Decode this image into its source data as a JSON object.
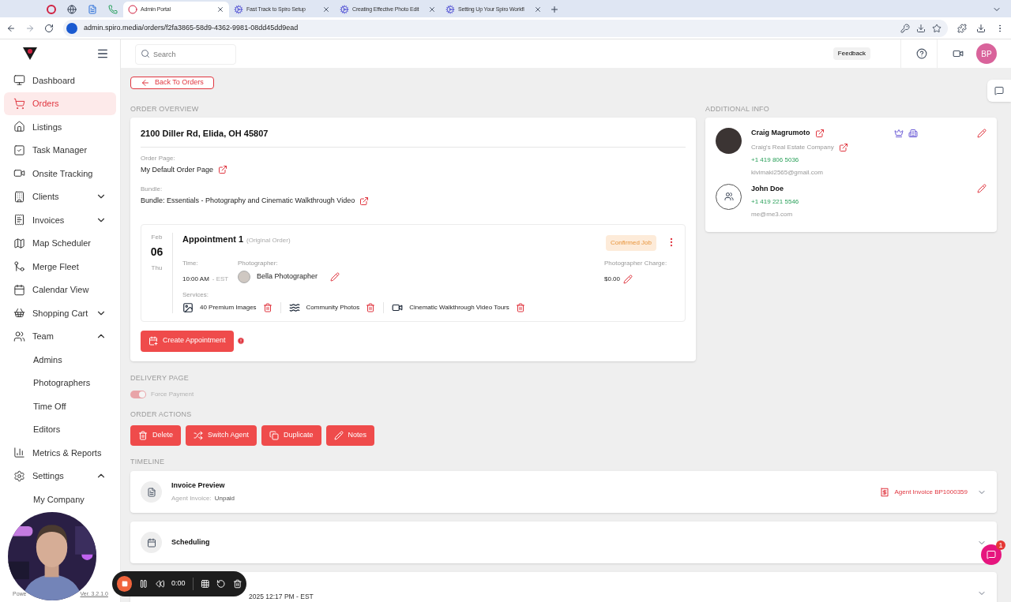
{
  "browser": {
    "tabs": [
      {
        "kind": "record",
        "selected": false
      },
      {
        "kind": "globe",
        "selected": false
      },
      {
        "kind": "doc",
        "selected": false
      },
      {
        "kind": "phone",
        "selected": false
      },
      {
        "kind": "portal",
        "title": "Admin Portal",
        "selected": true
      },
      {
        "kind": "gear",
        "title": "Fast Track to Spiro Setup",
        "selected": false
      },
      {
        "kind": "gear",
        "title": "Creating Effective Photo Edit",
        "selected": false
      },
      {
        "kind": "gear",
        "title": "Setting Up Your Spiro Workfl",
        "selected": false
      }
    ],
    "address": "admin.spiro.media/orders/f2fa3865-58d9-4362-9981-08dd45dd9ead"
  },
  "header": {
    "search_placeholder": "Search",
    "feedback": "Feedback",
    "avatar": "BP"
  },
  "sidebar": {
    "items": [
      {
        "label": "Dashboard",
        "selected": false
      },
      {
        "label": "Orders",
        "selected": true
      },
      {
        "label": "Listings",
        "selected": false
      },
      {
        "label": "Task Manager",
        "selected": false
      },
      {
        "label": "Onsite Tracking",
        "selected": false
      },
      {
        "label": "Clients",
        "selected": false,
        "expanded": false
      },
      {
        "label": "Invoices",
        "selected": false,
        "expanded": false
      },
      {
        "label": "Map Scheduler",
        "selected": false
      },
      {
        "label": "Merge Fleet",
        "selected": false
      },
      {
        "label": "Calendar View",
        "selected": false
      },
      {
        "label": "Shopping Cart",
        "selected": false,
        "expanded": false
      },
      {
        "label": "Team",
        "selected": false,
        "expanded": true,
        "children": [
          {
            "label": "Admins",
            "selected": false
          },
          {
            "label": "Photographers",
            "selected": false
          },
          {
            "label": "Time Off",
            "selected": false
          },
          {
            "label": "Editors",
            "selected": false
          }
        ]
      },
      {
        "label": "Metrics & Reports",
        "selected": false
      },
      {
        "label": "Settings",
        "selected": false,
        "expanded": true,
        "children": [
          {
            "label": "My Company",
            "selected": false
          }
        ]
      }
    ],
    "footer_left": "Powe",
    "version": "Ver. 3.2.1.0"
  },
  "back_button": "Back To Orders",
  "order_overview": {
    "heading": "ORDER OVERVIEW",
    "address": "2100 Diller Rd, Elida, OH 45807",
    "order_page_label": "Order Page:",
    "order_page": "My Default Order Page",
    "bundle_label": "Bundle:",
    "bundle": "Bundle: Essentials - Photography and Cinematic Walkthrough Video",
    "appointment": {
      "month": "Feb",
      "day": "06",
      "weekday": "Thu",
      "title": "Appointment 1",
      "note": "(Original Order)",
      "status": "Confirmed Job",
      "time_label": "Time:",
      "time": "10:00 AM",
      "timezone": "- EST",
      "photographer_label": "Photographer:",
      "photographer": "Bella Photographer",
      "charge_label": "Photographer Charge:",
      "charge": "$0.00",
      "services_label": "Services:",
      "services": [
        {
          "kind": "images",
          "name": "40 Premium Images"
        },
        {
          "kind": "community",
          "name": "Community Photos"
        },
        {
          "kind": "video",
          "name": "Cinematic Walkthrough Video Tours"
        }
      ]
    },
    "create_button": "Create Appointment"
  },
  "delivery": {
    "heading": "DELIVERY PAGE",
    "toggle_label": "Force Payment",
    "on": true,
    "disabled": true
  },
  "actions": {
    "heading": "ORDER ACTIONS",
    "buttons": [
      {
        "kind": "delete",
        "label": "Delete"
      },
      {
        "kind": "switch",
        "label": "Switch Agent"
      },
      {
        "kind": "duplicate",
        "label": "Duplicate"
      },
      {
        "kind": "notes",
        "label": "Notes"
      }
    ]
  },
  "timeline": {
    "heading": "TIMELINE",
    "rows": [
      {
        "kind": "invoice",
        "title": "Invoice Preview",
        "subtitle_label": "Agent Invoice:",
        "subtitle": "Unpaid",
        "link": "Agent Invoice BP1000359"
      },
      {
        "kind": "calendar",
        "title": "Scheduling"
      },
      {
        "kind": "partial",
        "text": "2025 12:17 PM - EST"
      }
    ]
  },
  "additional_info": {
    "heading": "ADDITIONAL INFO",
    "contacts": [
      {
        "name": "Craig Magrumoto",
        "company": "Craig's Real Estate Company",
        "phone": "+1 419 806 5036",
        "email": "kivimaki2565@gmail.com"
      },
      {
        "kind": "group",
        "name": "John Doe",
        "phone": "+1 419 221 5546",
        "email": "me@me3.com"
      }
    ]
  },
  "recorder": {
    "time": "0:00"
  },
  "chat": {
    "badge": "1"
  }
}
